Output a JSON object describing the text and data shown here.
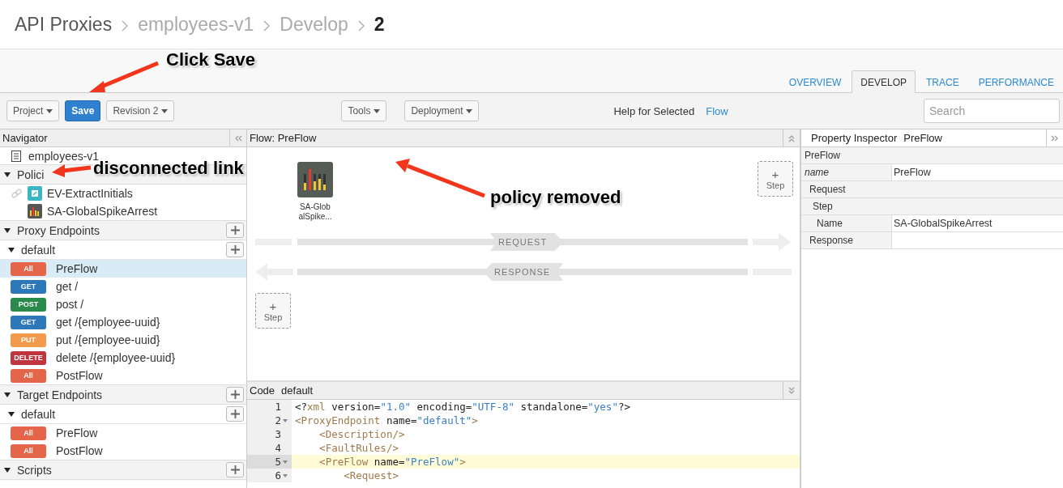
{
  "breadcrumb": [
    {
      "label": "API Proxies",
      "kind": "root"
    },
    {
      "label": "employees-v1",
      "kind": "link"
    },
    {
      "label": "Develop",
      "kind": "link"
    },
    {
      "label": "2",
      "kind": "current"
    }
  ],
  "tabs": [
    {
      "label": "OVERVIEW",
      "selected": false
    },
    {
      "label": "DEVELOP",
      "selected": true
    },
    {
      "label": "TRACE",
      "selected": false
    },
    {
      "label": "PERFORMANCE",
      "selected": false
    }
  ],
  "toolbar": {
    "left": [
      {
        "label": "Project",
        "kind": "dropdown"
      },
      {
        "label": "Save",
        "kind": "primary"
      },
      {
        "label": "Revision 2",
        "kind": "dropdown"
      }
    ],
    "middle": [
      {
        "label": "Tools",
        "kind": "dropdown"
      },
      {
        "label": "Deployment",
        "kind": "dropdown"
      }
    ],
    "help": {
      "label": "Help for Selected",
      "link": "Flow"
    },
    "search": {
      "placeholder": "Search"
    }
  },
  "navigator": {
    "title": "Navigator",
    "proxy": "employees-v1",
    "policies": {
      "label": "Polici",
      "expanded": true,
      "items": [
        {
          "label": "EV-ExtractInitials",
          "kind": "extract",
          "disconnected": true
        },
        {
          "label": "SA-GlobalSpikeArrest",
          "kind": "spike",
          "disconnected": false
        }
      ]
    },
    "sections": [
      {
        "label": "Proxy Endpoints",
        "expanded": true,
        "children": [
          {
            "label": "default",
            "expanded": true,
            "flows": [
              {
                "method": "All",
                "color": "#e5654b",
                "label": "PreFlow",
                "selected": true
              },
              {
                "method": "GET",
                "color": "#2d78b8",
                "label": "get /",
                "selected": false
              },
              {
                "method": "POST",
                "color": "#2a8a4b",
                "label": "post /",
                "selected": false
              },
              {
                "method": "GET",
                "color": "#2d78b8",
                "label": "get /{employee-uuid}",
                "selected": false
              },
              {
                "method": "PUT",
                "color": "#f39a4d",
                "label": "put /{employee-uuid}",
                "selected": false
              },
              {
                "method": "DELETE",
                "color": "#c1353f",
                "label": "delete /{employee-uuid}",
                "selected": false
              },
              {
                "method": "All",
                "color": "#e5654b",
                "label": "PostFlow",
                "selected": false
              }
            ]
          }
        ]
      },
      {
        "label": "Target Endpoints",
        "expanded": true,
        "children": [
          {
            "label": "default",
            "expanded": true,
            "flows": [
              {
                "method": "All",
                "color": "#e5654b",
                "label": "PreFlow",
                "selected": false
              },
              {
                "method": "All",
                "color": "#e5654b",
                "label": "PostFlow",
                "selected": false
              }
            ]
          }
        ]
      },
      {
        "label": "Scripts",
        "expanded": true
      }
    ]
  },
  "flow": {
    "title": "Flow: PreFlow",
    "policy": {
      "lines": [
        "SA-Glob",
        "alSpike..."
      ]
    },
    "steps": [
      {
        "plus": "+",
        "label": "Step"
      },
      {
        "plus": "+",
        "label": "Step"
      }
    ],
    "request": "REQUEST",
    "response": "RESPONSE"
  },
  "code": {
    "title": "Code",
    "name": "default",
    "lines": [
      {
        "number": "1",
        "fold": false,
        "current": false,
        "segments": [
          {
            "kind": "plain",
            "text": "<?"
          },
          {
            "kind": "tag",
            "text": "xml"
          },
          {
            "kind": "plain",
            "text": " version="
          },
          {
            "kind": "value",
            "text": "\"1.0\""
          },
          {
            "kind": "plain",
            "text": " encoding="
          },
          {
            "kind": "value",
            "text": "\"UTF-8\""
          },
          {
            "kind": "plain",
            "text": " standalone="
          },
          {
            "kind": "value",
            "text": "\"yes\""
          },
          {
            "kind": "plain",
            "text": "?>"
          }
        ]
      },
      {
        "number": "2",
        "fold": true,
        "current": false,
        "segments": [
          {
            "kind": "tag",
            "text": "<ProxyEndpoint"
          },
          {
            "kind": "plain",
            "text": " name="
          },
          {
            "kind": "value",
            "text": "\"default\""
          },
          {
            "kind": "tag",
            "text": ">"
          }
        ]
      },
      {
        "number": "3",
        "fold": false,
        "current": false,
        "segments": [
          {
            "kind": "tag",
            "text": "    <Description/>"
          }
        ]
      },
      {
        "number": "4",
        "fold": false,
        "current": false,
        "segments": [
          {
            "kind": "tag",
            "text": "    <FaultRules/>"
          }
        ]
      },
      {
        "number": "5",
        "fold": true,
        "current": true,
        "segments": [
          {
            "kind": "tag",
            "text": "    <PreFlow"
          },
          {
            "kind": "plain",
            "text": " name="
          },
          {
            "kind": "value",
            "text": "\"PreFlow\""
          },
          {
            "kind": "tag",
            "text": ">"
          }
        ]
      },
      {
        "number": "6",
        "fold": true,
        "current": false,
        "segments": [
          {
            "kind": "tag",
            "text": "        <Request>"
          }
        ]
      }
    ]
  },
  "inspector": {
    "title": "Property Inspector",
    "subject": "PreFlow",
    "rows": [
      {
        "kind": "header",
        "label": "PreFlow"
      },
      {
        "kind": "attribute",
        "label": "name",
        "value": "PreFlow"
      },
      {
        "kind": "group",
        "label": "Request"
      },
      {
        "kind": "subgroup",
        "label": "Step"
      },
      {
        "kind": "property",
        "label": "Name",
        "value": "SA-GlobalSpikeArrest"
      },
      {
        "kind": "property",
        "label": "Response",
        "value": ""
      }
    ]
  },
  "annotations": [
    {
      "text": "Click Save"
    },
    {
      "text": "disconnected link"
    },
    {
      "text": "policy removed"
    }
  ]
}
